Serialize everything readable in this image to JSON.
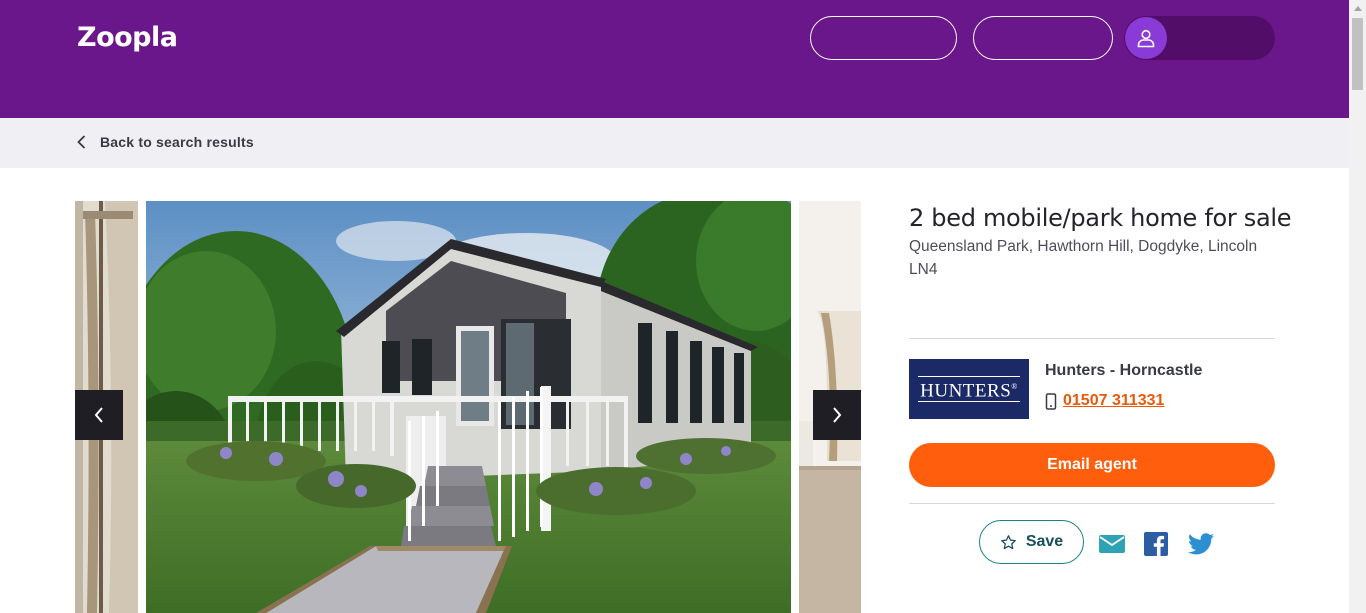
{
  "header": {
    "logo": "Zoopla",
    "brand_color": "#6b178c",
    "account_icon": "user-icon"
  },
  "backbar": {
    "back_label": "Back to search results",
    "back_icon": "chevron-left-icon"
  },
  "gallery": {
    "prev_icon": "chevron-left-icon",
    "next_icon": "chevron-right-icon"
  },
  "listing": {
    "title": "2 bed mobile/park home for sale",
    "address": "Queensland Park, Hawthorn Hill, Dogdyke, Lincoln LN4"
  },
  "agent": {
    "logo_text": "HUNTERS",
    "logo_mark": "®",
    "name": "Hunters - Horncastle",
    "phone_icon": "mobile-phone-icon",
    "phone": "01507 311331",
    "email_button": "Email agent",
    "accent_color": "#ff5f0c"
  },
  "actions": {
    "save_label": "Save",
    "save_icon": "star-icon",
    "share_icons": [
      "email-icon",
      "facebook-icon",
      "twitter-icon"
    ]
  }
}
